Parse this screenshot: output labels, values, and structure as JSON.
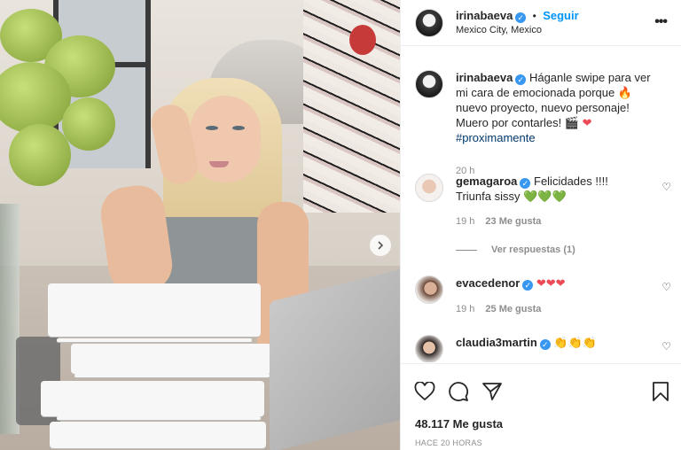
{
  "header": {
    "username": "irinabaeva",
    "follow_label": "Seguir",
    "location": "Mexico City, Mexico",
    "separator": "•",
    "more_label": "•••"
  },
  "caption": {
    "username": "irinabaeva",
    "text": "Háganle swipe para ver mi cara de emocionada porque",
    "fire": "🔥",
    "text2": "nuevo proyecto, nuevo personaje! Muero por contarles!",
    "clapper": "🎬",
    "heart": "❤",
    "hashtag": "#proximamente",
    "time": "20 h"
  },
  "comments": [
    {
      "username": "gemagaroa",
      "text": "Felicidades !!!! Triunfa sissy",
      "emojis": "💚💚💚",
      "time": "19 h",
      "likes": "23 Me gusta"
    },
    {
      "username": "evacedenor",
      "text": "",
      "emojis": "❤❤❤",
      "time": "19 h",
      "likes": "25 Me gusta"
    },
    {
      "username": "claudia3martin",
      "text": "",
      "emojis": "👏👏👏",
      "time": "",
      "likes": ""
    }
  ],
  "view_replies": "Ver respuestas (1)",
  "footer": {
    "likes": "48.117 Me gusta",
    "timestamp": "HACE 20 HORAS"
  },
  "colors": {
    "accent": "#0095f6",
    "verified": "#3897f0",
    "hashtag": "#00376b",
    "muted": "#8e8e8e",
    "text": "#262626"
  },
  "icons": [
    "verified-badge-icon",
    "more-options-icon",
    "like-heart-icon",
    "comment-icon",
    "share-icon",
    "save-bookmark-icon",
    "next-image-icon"
  ]
}
